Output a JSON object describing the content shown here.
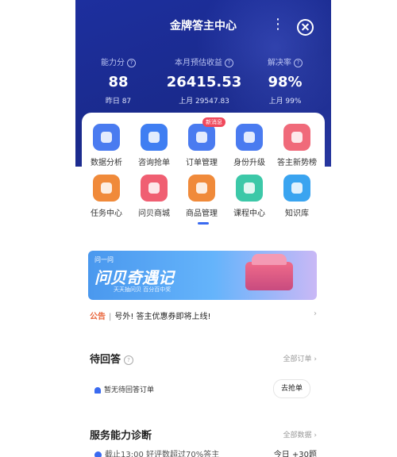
{
  "header": {
    "title": "金牌答主中心"
  },
  "stats": [
    {
      "label": "能力分",
      "value": "88",
      "sub": "昨日 87"
    },
    {
      "label": "本月预估收益",
      "value": "26415.53",
      "sub": "上月 29547.83"
    },
    {
      "label": "解决率",
      "value": "98%",
      "sub": "上月 99%"
    }
  ],
  "menu": [
    {
      "label": "数据分析",
      "icon": "chart-icon",
      "color": "#4a7bf0"
    },
    {
      "label": "咨询抢单",
      "icon": "lightning-icon",
      "color": "#3f7ef2"
    },
    {
      "label": "订单管理",
      "icon": "document-icon",
      "color": "#4a7bf0",
      "badge": "新消息"
    },
    {
      "label": "身份升级",
      "icon": "user-icon",
      "color": "#4a7bf0"
    },
    {
      "label": "答主新势榜",
      "icon": "trophy-icon",
      "color": "#f06a7a"
    },
    {
      "label": "任务中心",
      "icon": "task-icon",
      "color": "#f08a3a"
    },
    {
      "label": "问贝商城",
      "icon": "shell-icon",
      "color": "#f05f72"
    },
    {
      "label": "商品管理",
      "icon": "cart-icon",
      "color": "#f08a3a"
    },
    {
      "label": "课程中心",
      "icon": "play-icon",
      "color": "#3cc8a8"
    },
    {
      "label": "知识库",
      "icon": "book-icon",
      "color": "#3aa4f0"
    }
  ],
  "banner": {
    "tag": "问一问",
    "title": "问贝奇遇记",
    "subtitle": "天天抽问贝  百分百中奖"
  },
  "notice": {
    "label": "公告",
    "text": "号外! 答主优惠券即将上线!"
  },
  "pending": {
    "title": "待回答",
    "link": "全部订单",
    "empty": "暂无待回答订单",
    "action": "去抢单"
  },
  "diagnosis": {
    "title": "服务能力诊断",
    "link": "全部数据",
    "item": "截止13:00 好评数超过70%答主",
    "today": "今日 +30题"
  }
}
